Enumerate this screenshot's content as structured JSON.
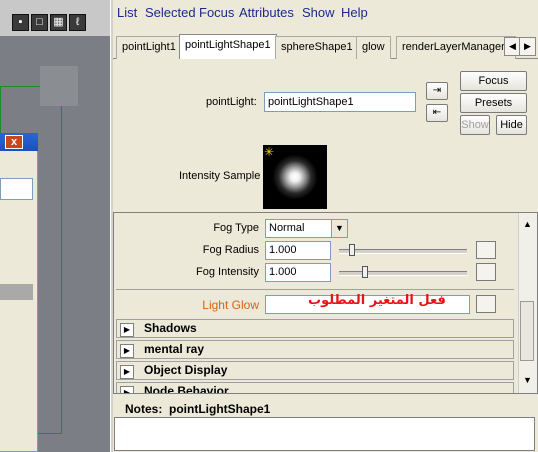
{
  "menubar": {
    "items": [
      "List",
      "Selected",
      "Focus",
      "Attributes",
      "Show",
      "Help"
    ]
  },
  "left": {
    "toolbar_icons": [
      "viewport-icon",
      "wire-cube-icon",
      "render-cube-icon",
      "lasso-icon"
    ],
    "window_close": "x"
  },
  "tabs": {
    "items": [
      "pointLight1",
      "pointLightShape1",
      "sphereShape1",
      "glow",
      "renderLayerManager"
    ],
    "active_index": 1,
    "scroll_left": "◀",
    "scroll_right": "▶"
  },
  "header": {
    "node_type_label": "pointLight:",
    "node_name": "pointLightShape1",
    "focus_btn": "Focus",
    "presets_btn": "Presets",
    "show_btn": "Show",
    "hide_btn": "Hide",
    "intensity_sample_label": "Intensity Sample"
  },
  "attributes": {
    "fog_type_label": "Fog Type",
    "fog_type_value": "Normal",
    "fog_radius_label": "Fog Radius",
    "fog_radius_value": "1.000",
    "fog_radius_slider": 0.1,
    "fog_intensity_label": "Fog Intensity",
    "fog_intensity_value": "1.000",
    "fog_intensity_slider": 0.2,
    "light_glow_label": "Light Glow",
    "light_glow_color": "#d2641e",
    "light_glow_annotation": "فعل المتغير المطلوب",
    "annotation_color": "#e81414",
    "sections": [
      "Shadows",
      "mental ray",
      "Object Display",
      "Node Behavior"
    ]
  },
  "notes": {
    "label": "Notes:  pointLightShape1"
  }
}
